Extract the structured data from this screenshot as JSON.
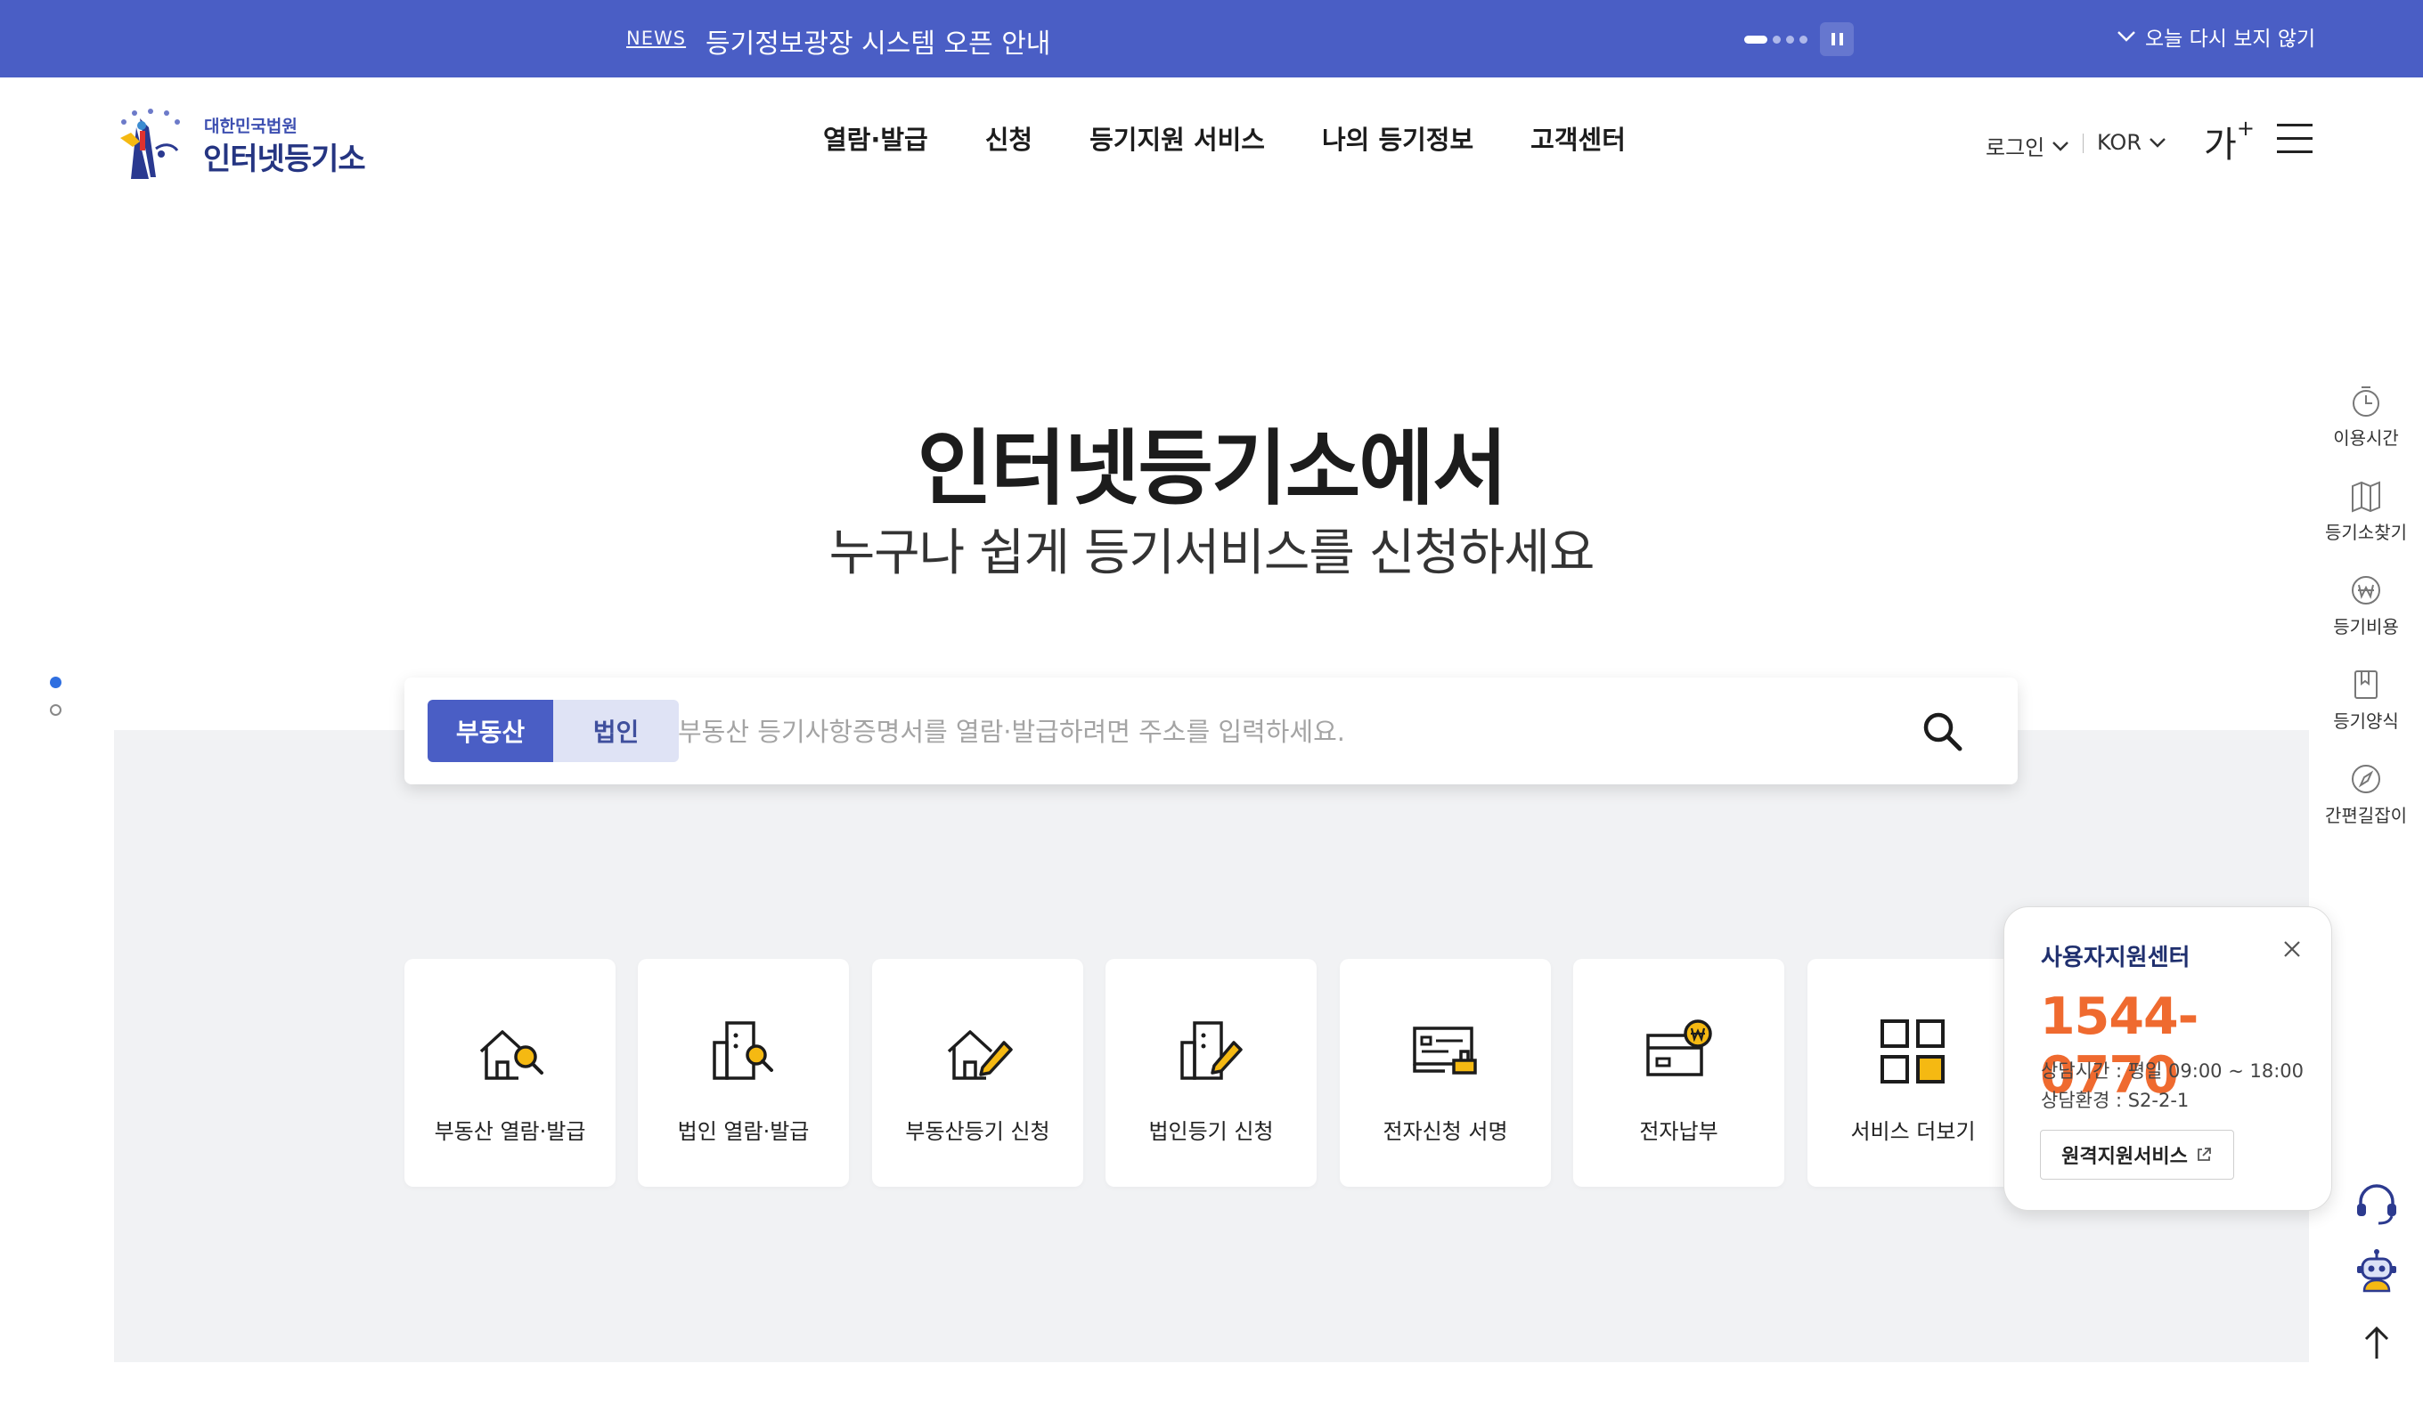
{
  "news": {
    "label": "NEWS",
    "text": "등기정보광장 시스템 오픈 안내",
    "close_label": "오늘 다시 보지 않기"
  },
  "header": {
    "logo_sub": "대한민국법원",
    "logo_main": "인터넷등기소",
    "nav": [
      "열람·발급",
      "신청",
      "등기지원 서비스",
      "나의 등기정보",
      "고객센터"
    ],
    "login": "로그인",
    "language": "KOR",
    "font_size_glyph": "가",
    "font_size_plus": "+"
  },
  "hero": {
    "title": "인터넷등기소에서",
    "subtitle": "누구나 쉽게 등기서비스를 신청하세요"
  },
  "search": {
    "tabs": [
      "부동산",
      "법인"
    ],
    "active_tab": "부동산",
    "placeholder": "부동산 등기사항증명서를 열람·발급하려면 주소를 입력하세요.",
    "value": ""
  },
  "services": [
    {
      "label": "부동산 열람·발급",
      "icon": "house-search-icon"
    },
    {
      "label": "법인 열람·발급",
      "icon": "building-search-icon"
    },
    {
      "label": "부동산등기 신청",
      "icon": "house-pencil-icon"
    },
    {
      "label": "법인등기 신청",
      "icon": "building-pencil-icon"
    },
    {
      "label": "전자신청 서명",
      "icon": "e-sign-icon"
    },
    {
      "label": "전자납부",
      "icon": "e-payment-icon"
    },
    {
      "label": "서비스 더보기",
      "icon": "grid-more-icon"
    }
  ],
  "quick_menu": [
    {
      "label": "이용시간",
      "icon": "clock-icon"
    },
    {
      "label": "등기소찾기",
      "icon": "map-icon"
    },
    {
      "label": "등기비용",
      "icon": "won-coin-icon"
    },
    {
      "label": "등기양식",
      "icon": "document-icon"
    },
    {
      "label": "간편길잡이",
      "icon": "compass-icon"
    }
  ],
  "support": {
    "title": "사용자지원센터",
    "phone": "1544-0770",
    "hours": "상담시간 : 평일 09:00 ~ 18:00",
    "env": "상담환경 : S2-2-1",
    "remote_button": "원격지원서비스"
  },
  "colors": {
    "primary": "#4a5ec5",
    "accent_orange": "#ef6a2f",
    "icon_yellow": "#f5b912"
  }
}
